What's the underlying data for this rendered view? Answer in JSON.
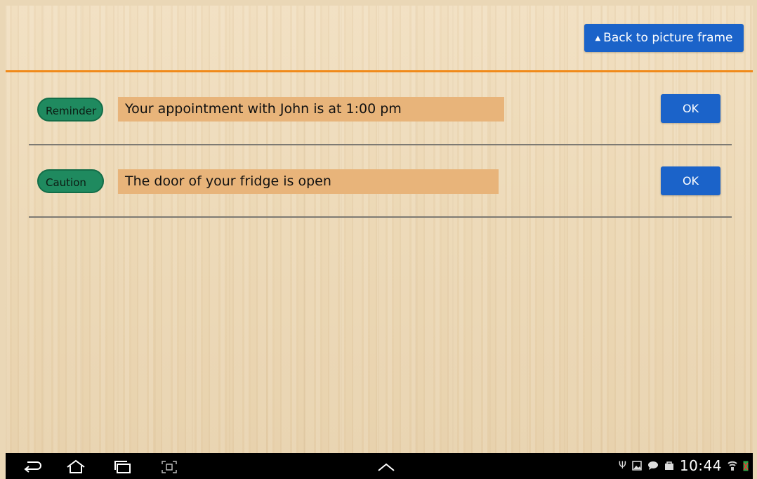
{
  "header": {
    "back_label": "Back to picture frame"
  },
  "notifications": [
    {
      "badge": "Reminder",
      "message": "Your appointment with John is at 1:00 pm",
      "ok_label": "OK"
    },
    {
      "badge": "Caution",
      "message": "The door of your fridge is open",
      "ok_label": "OK"
    }
  ],
  "status_bar": {
    "time": "10:44"
  },
  "colors": {
    "accent_blue": "#1b63c9",
    "badge_green": "#1f8a5f",
    "message_bg": "#e8b47a",
    "header_rule": "#f08a1a"
  }
}
